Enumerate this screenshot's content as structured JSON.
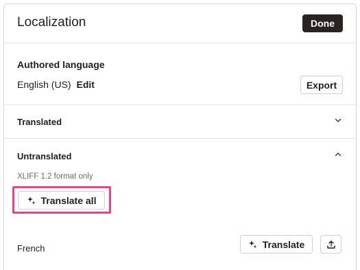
{
  "panel": {
    "title": "Localization",
    "done_label": "Done"
  },
  "authored": {
    "label": "Authored language",
    "language": "English (US)",
    "edit_label": "Edit",
    "export_label": "Export"
  },
  "translated": {
    "label": "Translated",
    "icon": "chevron-down-icon"
  },
  "untranslated": {
    "label": "Untranslated",
    "icon": "chevron-up-icon",
    "note": "XLIFF 1.2 format only",
    "translate_all_label": "Translate all",
    "languages": [
      {
        "name": "French",
        "translate_label": "Translate"
      }
    ]
  },
  "colors": {
    "primary_button": "#2b2321",
    "highlight": "#e8418d",
    "border": "#cfcfcf"
  }
}
